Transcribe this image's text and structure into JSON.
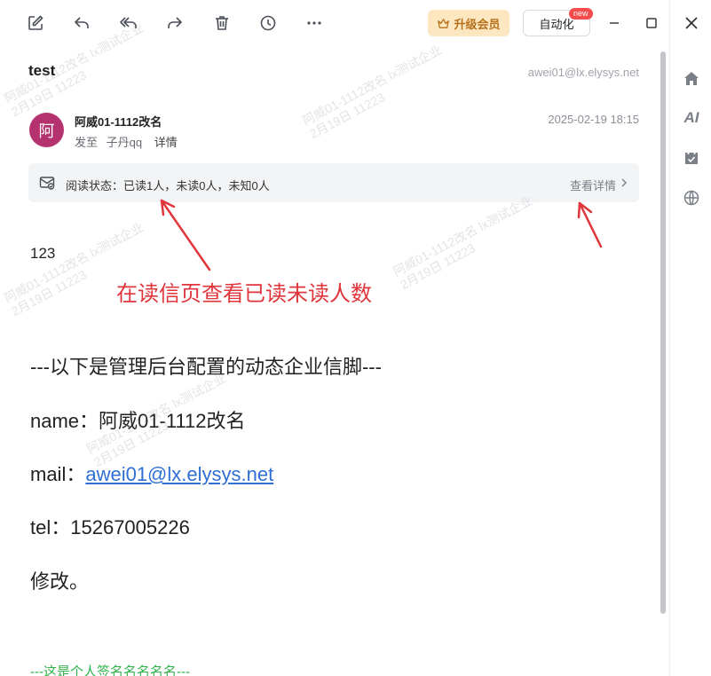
{
  "toolbar": {
    "upgrade_label": "升级会员",
    "automation_label": "自动化",
    "new_badge": "new"
  },
  "email": {
    "subject": "test",
    "mailbox": "awei01@lx.elysys.net",
    "avatar_char": "阿",
    "sender": "阿威01-1112改名",
    "to_label": "发至",
    "recipient": "子丹qq",
    "details_link": "详情",
    "datetime": "2025-02-19 18:15"
  },
  "read_status": {
    "text": "阅读状态：已读1人，未读0人，未知0人",
    "view_details": "查看详情"
  },
  "body": {
    "line1": "123",
    "annotation": "在读信页查看已读未读人数",
    "signature_header": "---以下是管理后台配置的动态企业信脚---",
    "name_label": "name：",
    "name_value": "阿威01-1112改名",
    "mail_label": "mail：",
    "mail_value": "awei01@lx.elysys.net",
    "tel_label": "tel：",
    "tel_value": "15267005226",
    "modified": "修改。",
    "personal_signature": "---这是个人签名名名名名---"
  },
  "watermark": {
    "line1": "阿威01-1112改名 lx测试企业",
    "line2": "2月19日  11223"
  },
  "colors": {
    "annotation": "#e0353b",
    "avatar": "#b4336f",
    "link": "#2f6fd6",
    "personal_signature": "#2fb24a",
    "upgrade_bg": "#fde7c1"
  },
  "sidebar": {
    "icons": [
      "close-icon",
      "home-icon",
      "ai-icon",
      "calendar-icon",
      "globe-icon"
    ],
    "ai_label": "AI"
  }
}
